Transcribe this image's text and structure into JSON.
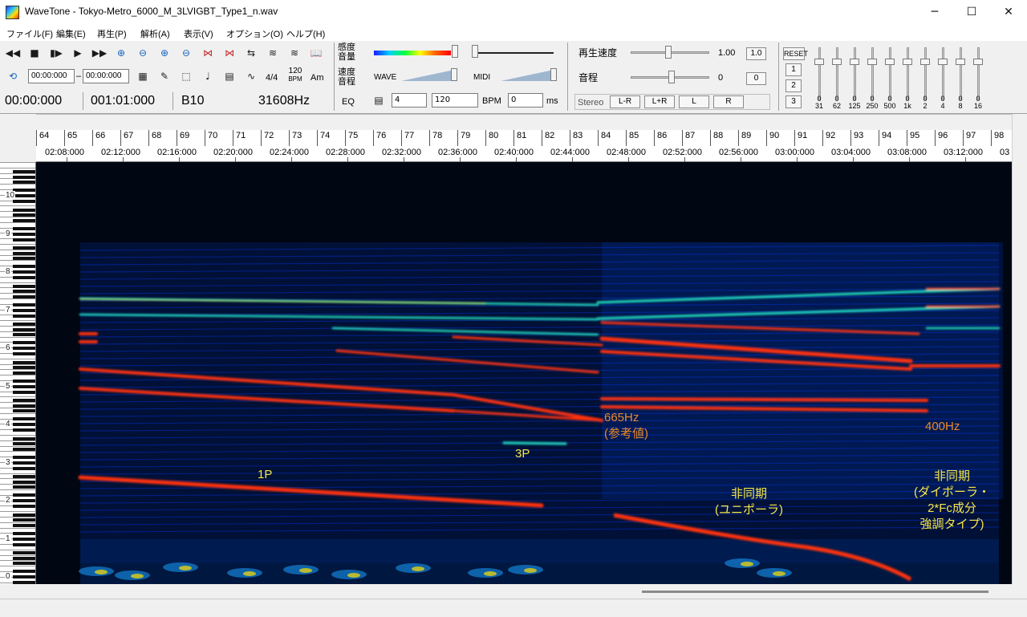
{
  "window": {
    "title": "WaveTone - Tokyo-Metro_6000_M_3LVIGBT_Type1_n.wav",
    "minimize": "─",
    "maximize": "☐",
    "close": "✕"
  },
  "menu": [
    "ファイル(F)",
    "編集(E)",
    "再生(P)",
    "解析(A)",
    "表示(V)",
    "オプション(O)",
    "ヘルプ(H)"
  ],
  "toolbar": {
    "range_start": "00:00:000",
    "range_dash": "–",
    "range_end": "00:00:000",
    "time_sig": "4/4",
    "bpm_icon_top": "120",
    "bpm_icon_bottom": "BPM",
    "am_label": "Am",
    "position": "00:00:000",
    "measure_pos": "001:01:000",
    "note": "B10",
    "frequency": "31608Hz",
    "sensitivity_l1": "感度",
    "sensitivity_l2": "音量",
    "speed_l1": "速度",
    "speed_l2": "音程",
    "eq_label": "EQ",
    "wave_label": "WAVE",
    "midi_label": "MIDI",
    "beats_value": "4",
    "bpm_value": "120",
    "bpm_label": "BPM",
    "ms_value": "0",
    "ms_label": "ms",
    "playback_speed_label": "再生速度",
    "playback_speed_value": "1.00",
    "playback_speed_reset": "1.0",
    "pitch_label": "音程",
    "pitch_value": "0",
    "pitch_reset": "0",
    "stereo_label": "Stereo",
    "ch_lmr": "L-R",
    "ch_lpr": "L+R",
    "ch_l": "L",
    "ch_r": "R",
    "eq_reset": "RESET",
    "eq_preset_1": "1",
    "eq_preset_2": "2",
    "eq_preset_3": "3",
    "eq_bands": [
      {
        "value": "0",
        "freq": "31"
      },
      {
        "value": "0",
        "freq": "62"
      },
      {
        "value": "0",
        "freq": "125"
      },
      {
        "value": "0",
        "freq": "250"
      },
      {
        "value": "0",
        "freq": "500"
      },
      {
        "value": "0",
        "freq": "1k"
      },
      {
        "value": "0",
        "freq": "2"
      },
      {
        "value": "0",
        "freq": "4"
      },
      {
        "value": "0",
        "freq": "8"
      },
      {
        "value": "0",
        "freq": "16"
      }
    ]
  },
  "ruler": {
    "measures": [
      "64",
      "65",
      "66",
      "67",
      "68",
      "69",
      "70",
      "71",
      "72",
      "73",
      "74",
      "75",
      "76",
      "77",
      "78",
      "79",
      "80",
      "81",
      "82",
      "83",
      "84",
      "85",
      "86",
      "87",
      "88",
      "89",
      "90",
      "91",
      "92",
      "93",
      "94",
      "95",
      "96",
      "97",
      "98"
    ],
    "times": [
      "02:08:000",
      "02:12:000",
      "02:16:000",
      "02:20:000",
      "02:24:000",
      "02:28:000",
      "02:32:000",
      "02:36:000",
      "02:40:000",
      "02:44:000",
      "02:48:000",
      "02:52:000",
      "02:56:000",
      "03:00:000",
      "03:04:000",
      "03:08:000",
      "03:12:000",
      "03"
    ]
  },
  "keyboard": {
    "octaves": [
      "10",
      "9",
      "8",
      "7",
      "6",
      "5",
      "4",
      "3",
      "2",
      "1",
      "0"
    ]
  },
  "annotations": {
    "label_1p": "1P",
    "label_3p": "3P",
    "label_665": "665Hz",
    "label_665_note": "(参考値)",
    "label_400": "400Hz",
    "uni_l1": "非同期",
    "uni_l2": "(ユニポーラ)",
    "dip_l1": "非同期",
    "dip_l2": "(ダイポーラ・",
    "dip_l3": "2*Fc成分",
    "dip_l4": "強調タイプ)"
  },
  "colors": {
    "annotation_yellow": "#f5e74a",
    "annotation_orange": "#e88a2a"
  }
}
